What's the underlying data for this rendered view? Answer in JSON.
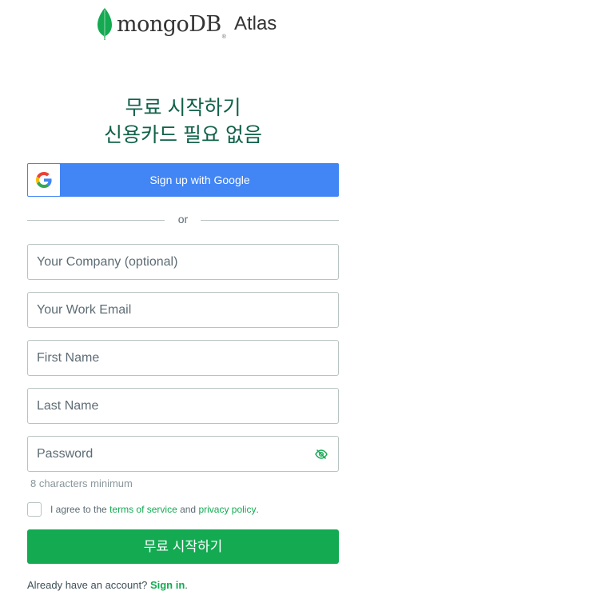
{
  "brand": {
    "wordmark": "mongoDB",
    "registered": "®",
    "product": "Atlas",
    "leaf_color": "#13aa52"
  },
  "heading": {
    "line1": "무료 시작하기",
    "line2": "신용카드 필요 없음"
  },
  "google_button": {
    "label": "Sign up with Google",
    "icon": "google-g-icon",
    "color": "#4285f4"
  },
  "divider": {
    "text": "or"
  },
  "form": {
    "company": {
      "placeholder": "Your Company (optional)",
      "value": ""
    },
    "email": {
      "placeholder": "Your Work Email",
      "value": ""
    },
    "first_name": {
      "placeholder": "First Name",
      "value": ""
    },
    "last_name": {
      "placeholder": "Last Name",
      "value": ""
    },
    "password": {
      "placeholder": "Password",
      "value": "",
      "toggle_icon": "eye-slash-icon"
    },
    "password_hint": "8 characters minimum"
  },
  "agreement": {
    "prefix": "I agree to the ",
    "terms": "terms of service",
    "middle": " and ",
    "privacy": "privacy policy",
    "suffix": ".",
    "checked": false
  },
  "submit_button": {
    "label": "무료 시작하기",
    "color": "#13aa52"
  },
  "signin": {
    "prefix": "Already have an account? ",
    "link": "Sign in",
    "suffix": "."
  }
}
